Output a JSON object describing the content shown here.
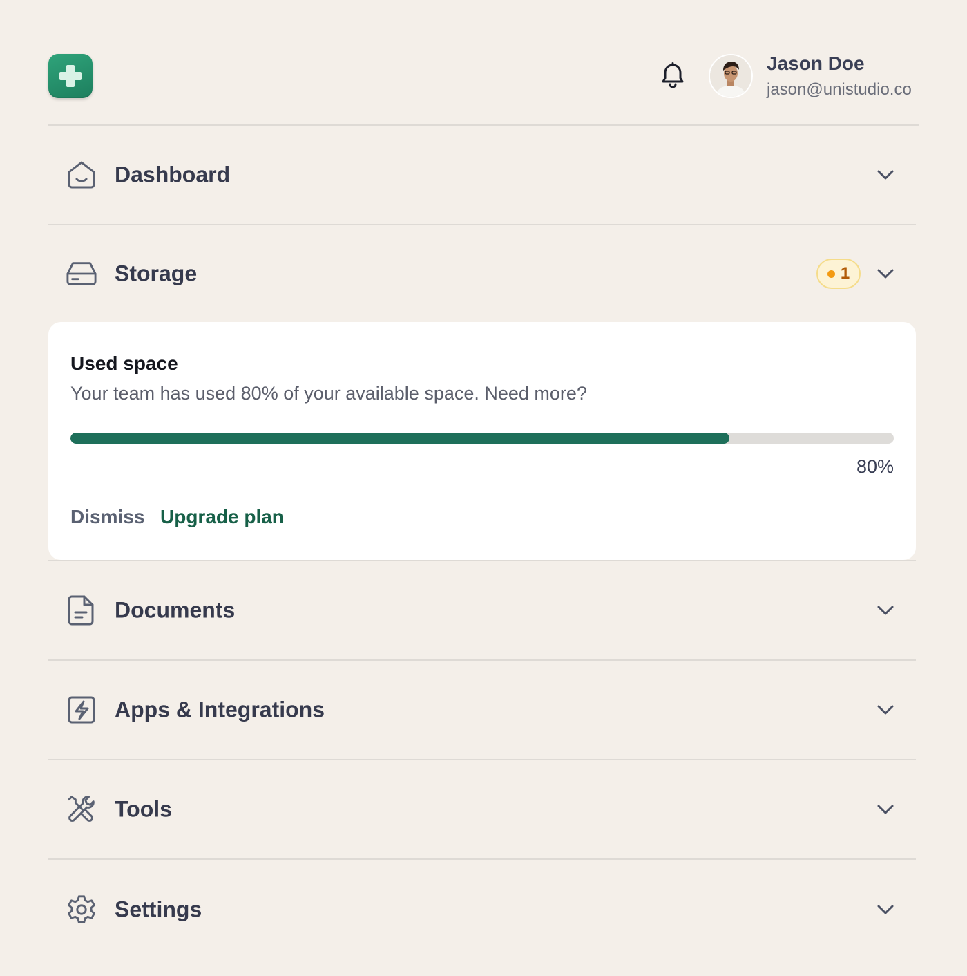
{
  "header": {
    "logo_icon": "plus-icon",
    "notification_icon": "bell-icon",
    "user": {
      "name": "Jason Doe",
      "email": "jason@unistudio.co"
    }
  },
  "nav": {
    "items": [
      {
        "label": "Dashboard",
        "icon": "home-icon"
      },
      {
        "label": "Storage",
        "icon": "hard-drive-icon",
        "badge_count": "1",
        "expanded": true
      },
      {
        "label": "Documents",
        "icon": "document-icon"
      },
      {
        "label": "Apps & Integrations",
        "icon": "bolt-square-icon"
      },
      {
        "label": "Tools",
        "icon": "tools-icon"
      },
      {
        "label": "Settings",
        "icon": "gear-icon"
      }
    ]
  },
  "storage_card": {
    "title": "Used space",
    "description": "Your team has used 80% of your available space. Need more?",
    "progress_fraction": 0.8,
    "progress_label": "80%",
    "dismiss_label": "Dismiss",
    "upgrade_label": "Upgrade plan"
  },
  "colors": {
    "background": "#f4efe9",
    "accent": "#1e6f5a",
    "logo": "#2a9a72",
    "badge_bg": "#fdf3d5",
    "badge_dot": "#f39a12"
  }
}
